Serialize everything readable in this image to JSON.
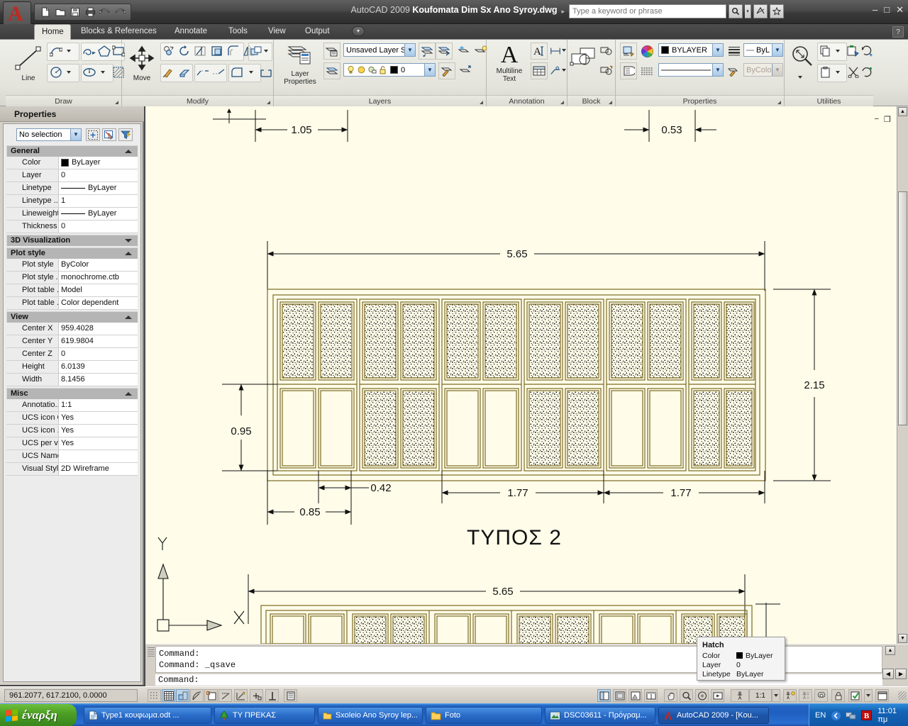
{
  "window": {
    "app_title_prefix": "AutoCAD 2009 ",
    "document_title": "Koufomata Dim Sx Ano Syroy.dwg",
    "taskbar_title": "AutoCAD 2009 - [Kou...",
    "minimize_label": "–",
    "maximize_label": "□",
    "close_label": "✕",
    "help_label": "?"
  },
  "quick_access": [
    {
      "name": "new-file-icon",
      "glyph": "new"
    },
    {
      "name": "open-file-icon",
      "glyph": "open"
    },
    {
      "name": "save-file-icon",
      "glyph": "save"
    },
    {
      "name": "plot-icon",
      "glyph": "plot"
    },
    {
      "name": "undo-icon",
      "glyph": "undo"
    },
    {
      "name": "redo-icon",
      "glyph": "redo"
    }
  ],
  "infocenter": {
    "placeholder": "Type a keyword or phrase",
    "search_icon": "search-icon",
    "dropdown_icon": "chevron-down-icon",
    "signin_icon": "communication-center-icon",
    "favorites_icon": "star-icon"
  },
  "ribbon": {
    "tabs": [
      {
        "label": "Home",
        "active": true
      },
      {
        "label": "Blocks & References",
        "active": false
      },
      {
        "label": "Annotate",
        "active": false
      },
      {
        "label": "Tools",
        "active": false
      },
      {
        "label": "View",
        "active": false
      },
      {
        "label": "Output",
        "active": false
      }
    ],
    "panels": [
      {
        "title": "Draw",
        "big_button": "Line"
      },
      {
        "title": "Modify",
        "big_button": "Move"
      },
      {
        "title": "Layers",
        "big_button": "Layer\nProperties"
      },
      {
        "title": "Annotation",
        "big_button": "Multiline\nText"
      },
      {
        "title": "Block",
        "big_button": ""
      },
      {
        "title": "Properties",
        "big_button": ""
      },
      {
        "title": "Utilities",
        "big_button": ""
      }
    ],
    "draw_big_label": "Line",
    "modify_big_label": "Move",
    "layers_big_label_1": "Layer",
    "layers_big_label_2": "Properties",
    "annotation_big_label_1": "Multiline",
    "annotation_big_label_2": "Text",
    "layer_state_combo": "Unsaved Layer S",
    "layer_name_combo": "0",
    "color_combo": "BYLAYER",
    "lineweight_combo": "ByL",
    "linetype_combo": "",
    "plotstyle_combo": "ByColor"
  },
  "properties_palette": {
    "title": "Properties",
    "selection": "No selection",
    "buttons": [
      {
        "name": "quick-select-button",
        "label": "quick-select-icon"
      },
      {
        "name": "select-objects-button",
        "label": "select-objects-icon"
      },
      {
        "name": "quick-select-filter-button",
        "label": "filter-icon"
      }
    ],
    "categories": [
      {
        "name": "General",
        "expanded": true,
        "rows": [
          {
            "key": "Color",
            "value": "ByLayer",
            "swatch": true
          },
          {
            "key": "Layer",
            "value": "0"
          },
          {
            "key": "Linetype",
            "value": "ByLayer",
            "line": true
          },
          {
            "key": "Linetype ...",
            "value": "1"
          },
          {
            "key": "Lineweight",
            "value": "ByLayer",
            "line": true
          },
          {
            "key": "Thickness",
            "value": "0"
          }
        ]
      },
      {
        "name": "3D Visualization",
        "expanded": false,
        "rows": []
      },
      {
        "name": "Plot style",
        "expanded": true,
        "rows": [
          {
            "key": "Plot style",
            "value": "ByColor"
          },
          {
            "key": "Plot style ...",
            "value": "monochrome.ctb"
          },
          {
            "key": "Plot table ...",
            "value": "Model"
          },
          {
            "key": "Plot table ...",
            "value": "Color dependent"
          }
        ]
      },
      {
        "name": "View",
        "expanded": true,
        "rows": [
          {
            "key": "Center X",
            "value": "959.4028"
          },
          {
            "key": "Center Y",
            "value": "619.9804"
          },
          {
            "key": "Center Z",
            "value": "0"
          },
          {
            "key": "Height",
            "value": "6.0139"
          },
          {
            "key": "Width",
            "value": "8.1456"
          }
        ]
      },
      {
        "name": "Misc",
        "expanded": true,
        "rows": [
          {
            "key": "Annotatio...",
            "value": "1:1"
          },
          {
            "key": "UCS icon On",
            "value": "Yes"
          },
          {
            "key": "UCS icon ...",
            "value": "Yes"
          },
          {
            "key": "UCS per v...",
            "value": "Yes"
          },
          {
            "key": "UCS Name",
            "value": ""
          },
          {
            "key": "Visual Style",
            "value": "2D Wireframe"
          }
        ]
      }
    ]
  },
  "drawing": {
    "title_label": "ΤΥΠΟΣ 2",
    "ucs": {
      "x_label": "X",
      "y_label": "Y"
    },
    "dimensions": {
      "top_left": "1.05",
      "top_right": "0.53",
      "overall_width": "5.65",
      "overall_height": "2.15",
      "left_height": "0.95",
      "bottom_1": "0.85",
      "bottom_2": "0.42",
      "bottom_3": "1.77",
      "bottom_4": "1.77",
      "lower_overall_width": "5.65"
    },
    "colors": {
      "background": "#fffce9",
      "geometry": "#7a6a22",
      "dimension": "#111111"
    },
    "minimize_label": "−",
    "restore_label": "❐",
    "close_label": "✕"
  },
  "command_line": {
    "history": [
      "Command:",
      "Command: _qsave"
    ],
    "prompt": "Command:"
  },
  "tooltip": {
    "title": "Hatch",
    "rows": [
      {
        "key": "Color",
        "value": "ByLayer",
        "swatch": true
      },
      {
        "key": "Layer",
        "value": "0"
      },
      {
        "key": "Linetype",
        "value": "ByLayer"
      }
    ]
  },
  "status_bar": {
    "coordinates": "961.2077, 617.2100, 0.0000",
    "left_toggles": [
      {
        "name": "infer-constraints-toggle",
        "on": false
      },
      {
        "name": "snap-mode-toggle",
        "on": false
      },
      {
        "name": "grid-display-toggle",
        "on": true
      },
      {
        "name": "ortho-mode-toggle",
        "on": true
      },
      {
        "name": "polar-tracking-toggle",
        "on": false
      },
      {
        "name": "object-snap-toggle",
        "on": false
      },
      {
        "name": "osnap-tracking-toggle",
        "on": false
      },
      {
        "name": "dynamic-ucs-toggle",
        "on": false
      },
      {
        "name": "dynamic-input-toggle",
        "on": false
      },
      {
        "name": "lineweight-toggle",
        "on": false
      },
      {
        "name": "quick-properties-toggle",
        "on": false
      }
    ],
    "right_tools": [
      {
        "name": "model-layout-button",
        "on": true
      },
      {
        "name": "quick-view-layouts-button",
        "on": false
      },
      {
        "name": "quick-view-drawings-button",
        "on": false
      },
      {
        "name": "pan-button",
        "on": false
      },
      {
        "name": "zoom-button",
        "on": false
      },
      {
        "name": "steering-wheel-button",
        "on": false
      },
      {
        "name": "showmotion-button",
        "on": false
      }
    ],
    "annotation_scale": "1:1",
    "scale_dropdown_icon": "chevron-down-icon",
    "workspace_icon": "gear-icon",
    "lock_icon": "lock-icon",
    "clean_screen_icon": "clean-screen-icon"
  },
  "taskbar": {
    "start_label": "έναρξη",
    "items": [
      {
        "label": "Type1 κουφωμα.odt ...",
        "icon": "document-icon",
        "active": false
      },
      {
        "label": "ΤΥ ΠΡΕΚΑΣ",
        "icon": "tree-icon",
        "active": false
      },
      {
        "label": "Sxoleio Ano Syroy lep...",
        "icon": "folder-icon",
        "active": false
      },
      {
        "label": "Foto",
        "icon": "folder-icon",
        "active": false
      },
      {
        "label": "DSC03611 - Πρόγραμ...",
        "icon": "image-icon",
        "active": false
      },
      {
        "label": "AutoCAD 2009 - [Kou...",
        "icon": "autocad-icon",
        "active": true
      }
    ],
    "tray": {
      "language": "EN",
      "clock": "11:01 πμ",
      "icons": [
        "show-hidden-icon",
        "network-icon",
        "bitdefender-icon"
      ]
    }
  }
}
